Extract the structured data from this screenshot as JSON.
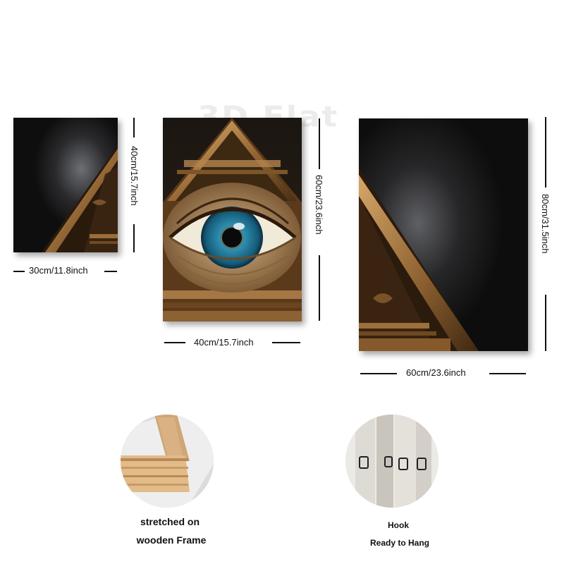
{
  "watermark": "3D Flat",
  "panels": {
    "small": {
      "width_label": "30cm/11.8inch",
      "height_label": "40cm/15.7inch"
    },
    "medium": {
      "width_label": "40cm/15.7inch",
      "height_label": "60cm/23.6inch"
    },
    "large": {
      "width_label": "60cm/23.6inch",
      "height_label": "80cm/31.5inch"
    }
  },
  "details": {
    "frame": {
      "line1": "stretched on",
      "line2": "wooden Frame"
    },
    "hook": {
      "line1": "Hook",
      "line2": "Ready to Hang"
    }
  },
  "colors": {
    "gold": "#b8894f",
    "dark_gold": "#5a3a1a",
    "background_dark": "#14110f",
    "iris_blue": "#2f8fb0"
  }
}
